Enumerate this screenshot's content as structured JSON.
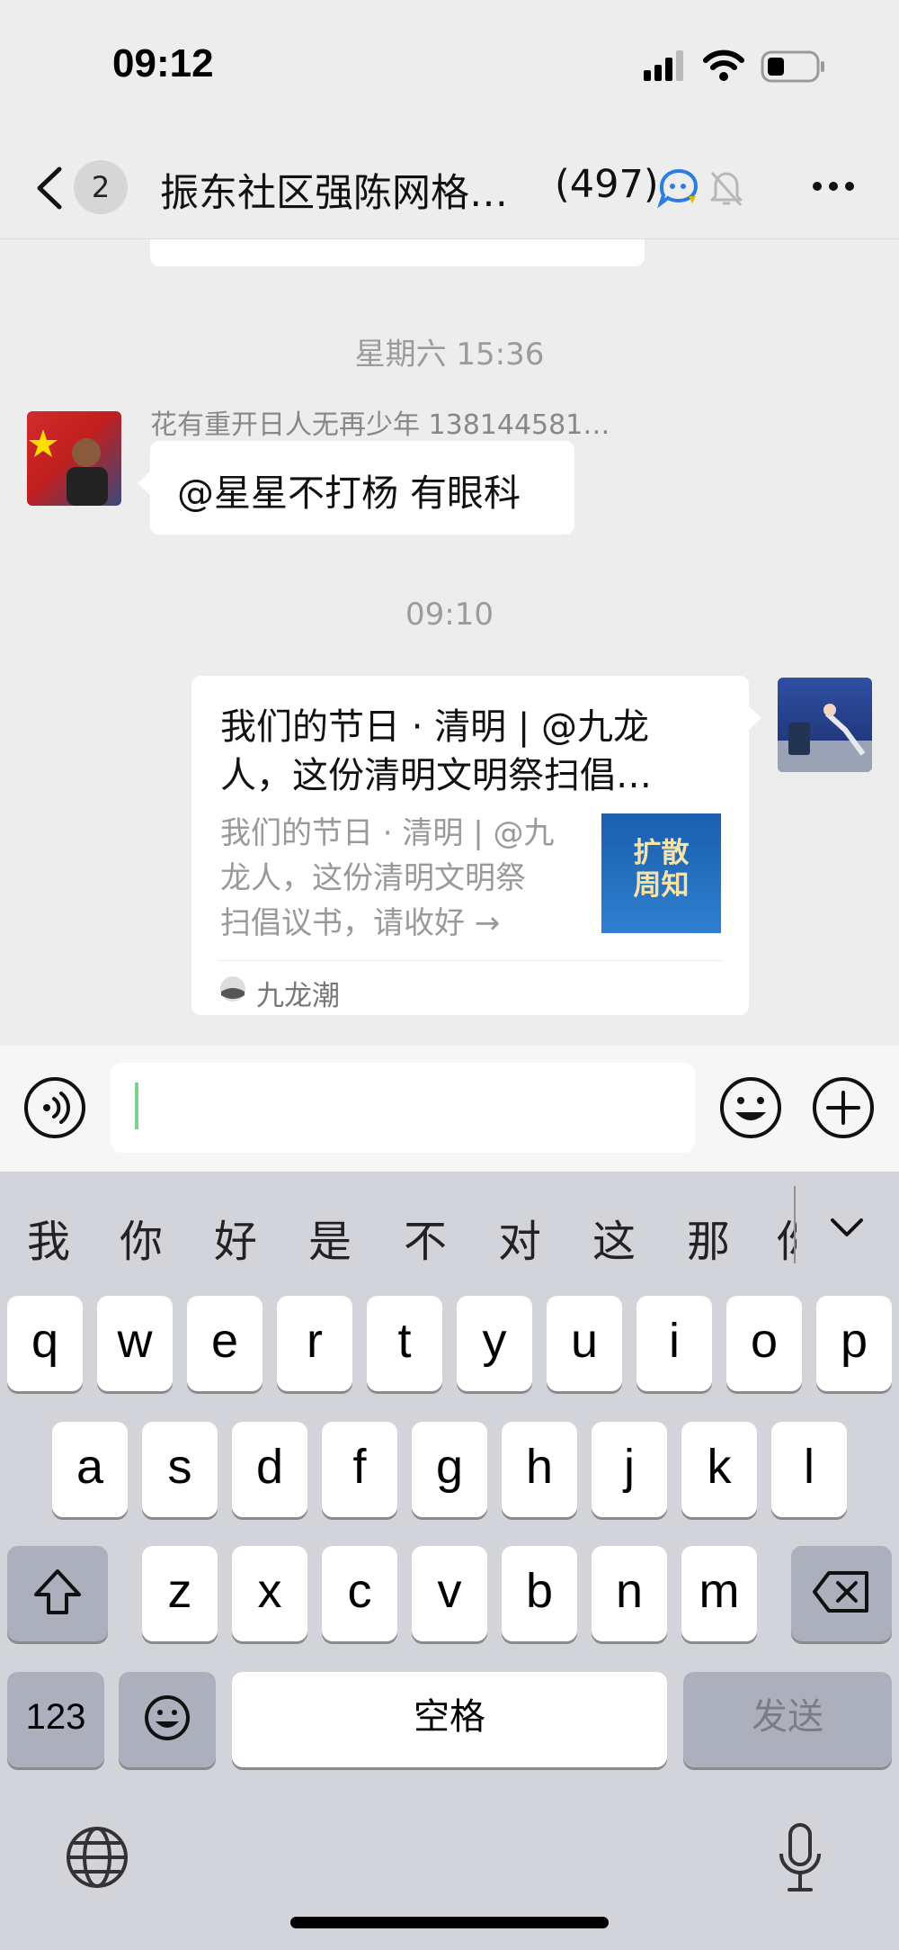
{
  "status_bar": {
    "time": "09:12"
  },
  "nav": {
    "back_badge": "2",
    "title": "振东社区强陈网格…",
    "member_count": "(497)"
  },
  "chat": {
    "timestamps": [
      "星期六 15:36",
      "09:10"
    ],
    "message_1": {
      "sender": "花有重开日人无再少年 138144581…",
      "text": "@星星不打杨 有眼科"
    },
    "link_card": {
      "title": "我们的节日 · 清明 | @九龙人，这份清明文明祭扫倡…",
      "title_line1": "我们的节日 · 清明 | @九龙",
      "title_line2": "人，这份清明文明祭扫倡…",
      "desc_line1": "我们的节日 · 清明 | @九",
      "desc_line2": "龙人，这份清明文明祭",
      "desc_line3": "扫倡议书，请收好 →",
      "thumb_text_1": "扩散",
      "thumb_text_2": "周知",
      "source": "九龙潮"
    }
  },
  "input": {
    "value": ""
  },
  "keyboard": {
    "candidates": [
      "我",
      "你",
      "好",
      "是",
      "不",
      "对",
      "这",
      "那",
      "你"
    ],
    "row1": [
      "q",
      "w",
      "e",
      "r",
      "t",
      "y",
      "u",
      "i",
      "o",
      "p"
    ],
    "row2": [
      "a",
      "s",
      "d",
      "f",
      "g",
      "h",
      "j",
      "k",
      "l"
    ],
    "row3": [
      "z",
      "x",
      "c",
      "v",
      "b",
      "n",
      "m"
    ],
    "numbers_label": "123",
    "space_label": "空格",
    "send_label": "发送"
  },
  "colors": {
    "background": "#ededed",
    "keyboard": "#d2d4da",
    "accent_green": "#7bd48f",
    "flag_red": "#d22b2b"
  }
}
